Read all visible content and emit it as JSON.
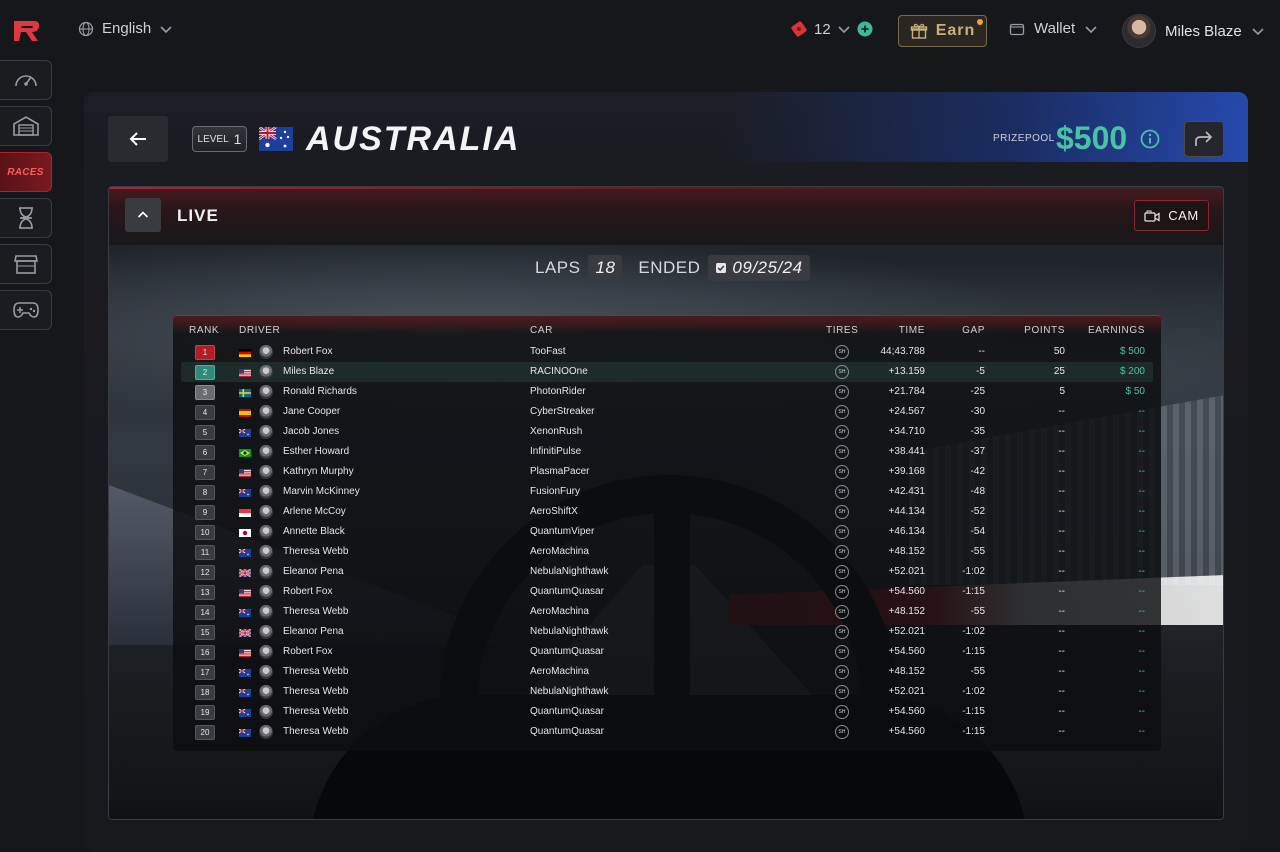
{
  "topbar": {
    "language": "English",
    "tokens": "12",
    "earn_label": "Earn",
    "wallet_label": "Wallet",
    "username": "Miles Blaze"
  },
  "sidebar": {
    "items": [
      {
        "icon": "dashboard-gauge-icon"
      },
      {
        "icon": "garage-icon"
      },
      {
        "label": "RACES",
        "active": true
      },
      {
        "icon": "dna-icon"
      },
      {
        "icon": "store-icon"
      },
      {
        "icon": "gamepad-icon"
      }
    ]
  },
  "race": {
    "level_label": "LEVEL",
    "level_value": "1",
    "title": "AUSTRALIA",
    "prize_label": "PRIZEPOOL",
    "prize_value": "$500"
  },
  "live": {
    "label": "LIVE",
    "cam_label": "CAM",
    "laps_label": "LAPS",
    "laps_value": "18",
    "status_label": "ENDED",
    "date": "09/25/24"
  },
  "table": {
    "headers": {
      "rank": "RANK",
      "driver": "DRIVER",
      "car": "CAR",
      "tires": "TIRES",
      "time": "TIME",
      "gap": "GAP",
      "points": "POINTS",
      "earnings": "EARNINGS"
    },
    "tire_label": "SH",
    "rows": [
      {
        "rank": "1",
        "country": "de",
        "driver": "Robert Fox",
        "car": "TooFast",
        "time": "44;43.788",
        "gap": "--",
        "points": "50",
        "earnings": "$ 500"
      },
      {
        "rank": "2",
        "country": "us",
        "driver": "Miles Blaze",
        "car": "RACINOOne",
        "time": "+13.159",
        "gap": "-5",
        "points": "25",
        "earnings": "$ 200"
      },
      {
        "rank": "3",
        "country": "se",
        "driver": "Ronald Richards",
        "car": "PhotonRider",
        "time": "+21.784",
        "gap": "-25",
        "points": "5",
        "earnings": "$ 50"
      },
      {
        "rank": "4",
        "country": "es",
        "driver": "Jane Cooper",
        "car": "CyberStreaker",
        "time": "+24.567",
        "gap": "-30",
        "points": "--",
        "earnings": "--"
      },
      {
        "rank": "5",
        "country": "au",
        "driver": "Jacob Jones",
        "car": "XenonRush",
        "time": "+34.710",
        "gap": "-35",
        "points": "--",
        "earnings": "--"
      },
      {
        "rank": "6",
        "country": "br",
        "driver": "Esther Howard",
        "car": "InfinitiPulse",
        "time": "+38.441",
        "gap": "-37",
        "points": "--",
        "earnings": "--"
      },
      {
        "rank": "7",
        "country": "us",
        "driver": "Kathryn Murphy",
        "car": "PlasmaPacer",
        "time": "+39.168",
        "gap": "-42",
        "points": "--",
        "earnings": "--"
      },
      {
        "rank": "8",
        "country": "au",
        "driver": "Marvin McKinney",
        "car": "FusionFury",
        "time": "+42.431",
        "gap": "-48",
        "points": "--",
        "earnings": "--"
      },
      {
        "rank": "9",
        "country": "sg",
        "driver": "Arlene McCoy",
        "car": "AeroShiftX",
        "time": "+44.134",
        "gap": "-52",
        "points": "--",
        "earnings": "--"
      },
      {
        "rank": "10",
        "country": "jp",
        "driver": "Annette Black",
        "car": "QuantumViper",
        "time": "+46.134",
        "gap": "-54",
        "points": "--",
        "earnings": "--"
      },
      {
        "rank": "11",
        "country": "au",
        "driver": "Theresa Webb",
        "car": "AeroMachina",
        "time": "+48.152",
        "gap": "-55",
        "points": "--",
        "earnings": "--"
      },
      {
        "rank": "12",
        "country": "gb",
        "driver": "Eleanor Pena",
        "car": "NebulaNighthawk",
        "time": "+52.021",
        "gap": "-1:02",
        "points": "--",
        "earnings": "--"
      },
      {
        "rank": "13",
        "country": "us",
        "driver": "Robert Fox",
        "car": "QuantumQuasar",
        "time": "+54.560",
        "gap": "-1:15",
        "points": "--",
        "earnings": "--"
      },
      {
        "rank": "14",
        "country": "au",
        "driver": "Theresa Webb",
        "car": "AeroMachina",
        "time": "+48.152",
        "gap": "-55",
        "points": "--",
        "earnings": "--"
      },
      {
        "rank": "15",
        "country": "gb",
        "driver": "Eleanor Pena",
        "car": "NebulaNighthawk",
        "time": "+52.021",
        "gap": "-1:02",
        "points": "--",
        "earnings": "--"
      },
      {
        "rank": "16",
        "country": "us",
        "driver": "Robert Fox",
        "car": "QuantumQuasar",
        "time": "+54.560",
        "gap": "-1:15",
        "points": "--",
        "earnings": "--"
      },
      {
        "rank": "17",
        "country": "au",
        "driver": "Theresa Webb",
        "car": "AeroMachina",
        "time": "+48.152",
        "gap": "-55",
        "points": "--",
        "earnings": "--"
      },
      {
        "rank": "18",
        "country": "au",
        "driver": "Theresa Webb",
        "car": "NebulaNighthawk",
        "time": "+52.021",
        "gap": "-1:02",
        "points": "--",
        "earnings": "--"
      },
      {
        "rank": "19",
        "country": "au",
        "driver": "Theresa Webb",
        "car": "QuantumQuasar",
        "time": "+54.560",
        "gap": "-1:15",
        "points": "--",
        "earnings": "--"
      },
      {
        "rank": "20",
        "country": "au",
        "driver": "Theresa Webb",
        "car": "QuantumQuasar",
        "time": "+54.560",
        "gap": "-1:15",
        "points": "--",
        "earnings": "--"
      }
    ]
  },
  "colors": {
    "accent_green": "#49c3a6",
    "accent_red": "#b01e24",
    "gold": "#c9b27a"
  }
}
